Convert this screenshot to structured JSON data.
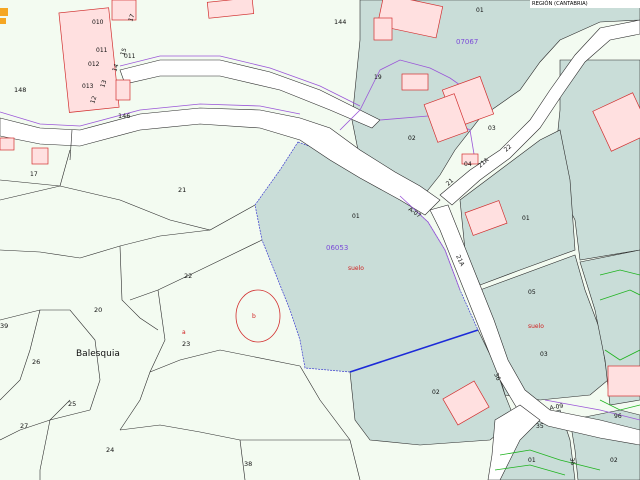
{
  "header": {
    "region_label": "REGIÓN (CANTABRIA)"
  },
  "colors": {
    "background": "#f3fbf1",
    "parcel_fill": "#c9ddd8",
    "road_fill": "#ffffff",
    "boundary_line": "#2b2b2b",
    "purple_line": "#9b57d8",
    "selection_line": "#1c2ad8",
    "building_outline": "#d23030",
    "green_contour": "#1fb31f"
  },
  "labels": {
    "l144": "144",
    "l146": "146",
    "l148": "148",
    "l010": "010",
    "l011": "011",
    "l012": "012",
    "l013": "013",
    "l011b": "011",
    "l19": "19",
    "l17": "17",
    "l15": "15",
    "l14": "14",
    "l13": "13",
    "l12": "12",
    "l17b": "17",
    "l21": "21",
    "l22": "22",
    "l20": "20",
    "l23": "23",
    "l26": "26",
    "l25": "25",
    "l27": "27",
    "l24": "24",
    "l38": "38",
    "l39": "39",
    "place_balesquia": "Balesquia",
    "ref_07067": "07067",
    "ref_06053": "06053",
    "p01_top": "01",
    "p02_right": "02",
    "p03_right": "03",
    "p04": "04",
    "p01_center": "01",
    "p01_right": "01",
    "p05": "05",
    "p03_lower": "03",
    "p02_lower": "02",
    "p01_bottom": "01",
    "p02_bottom": "02",
    "road_a07": "A-07",
    "road_21a": "21A",
    "road_21a_b": "21A",
    "road_21": "21",
    "road_22": "22",
    "road_36": "36",
    "road_a09": "A-09",
    "road_35": "35",
    "road_36b": "36",
    "road_96": "96",
    "b_label": "b",
    "a_label": "a",
    "red_label_center": "suelo",
    "red_label_right": "suelo"
  }
}
